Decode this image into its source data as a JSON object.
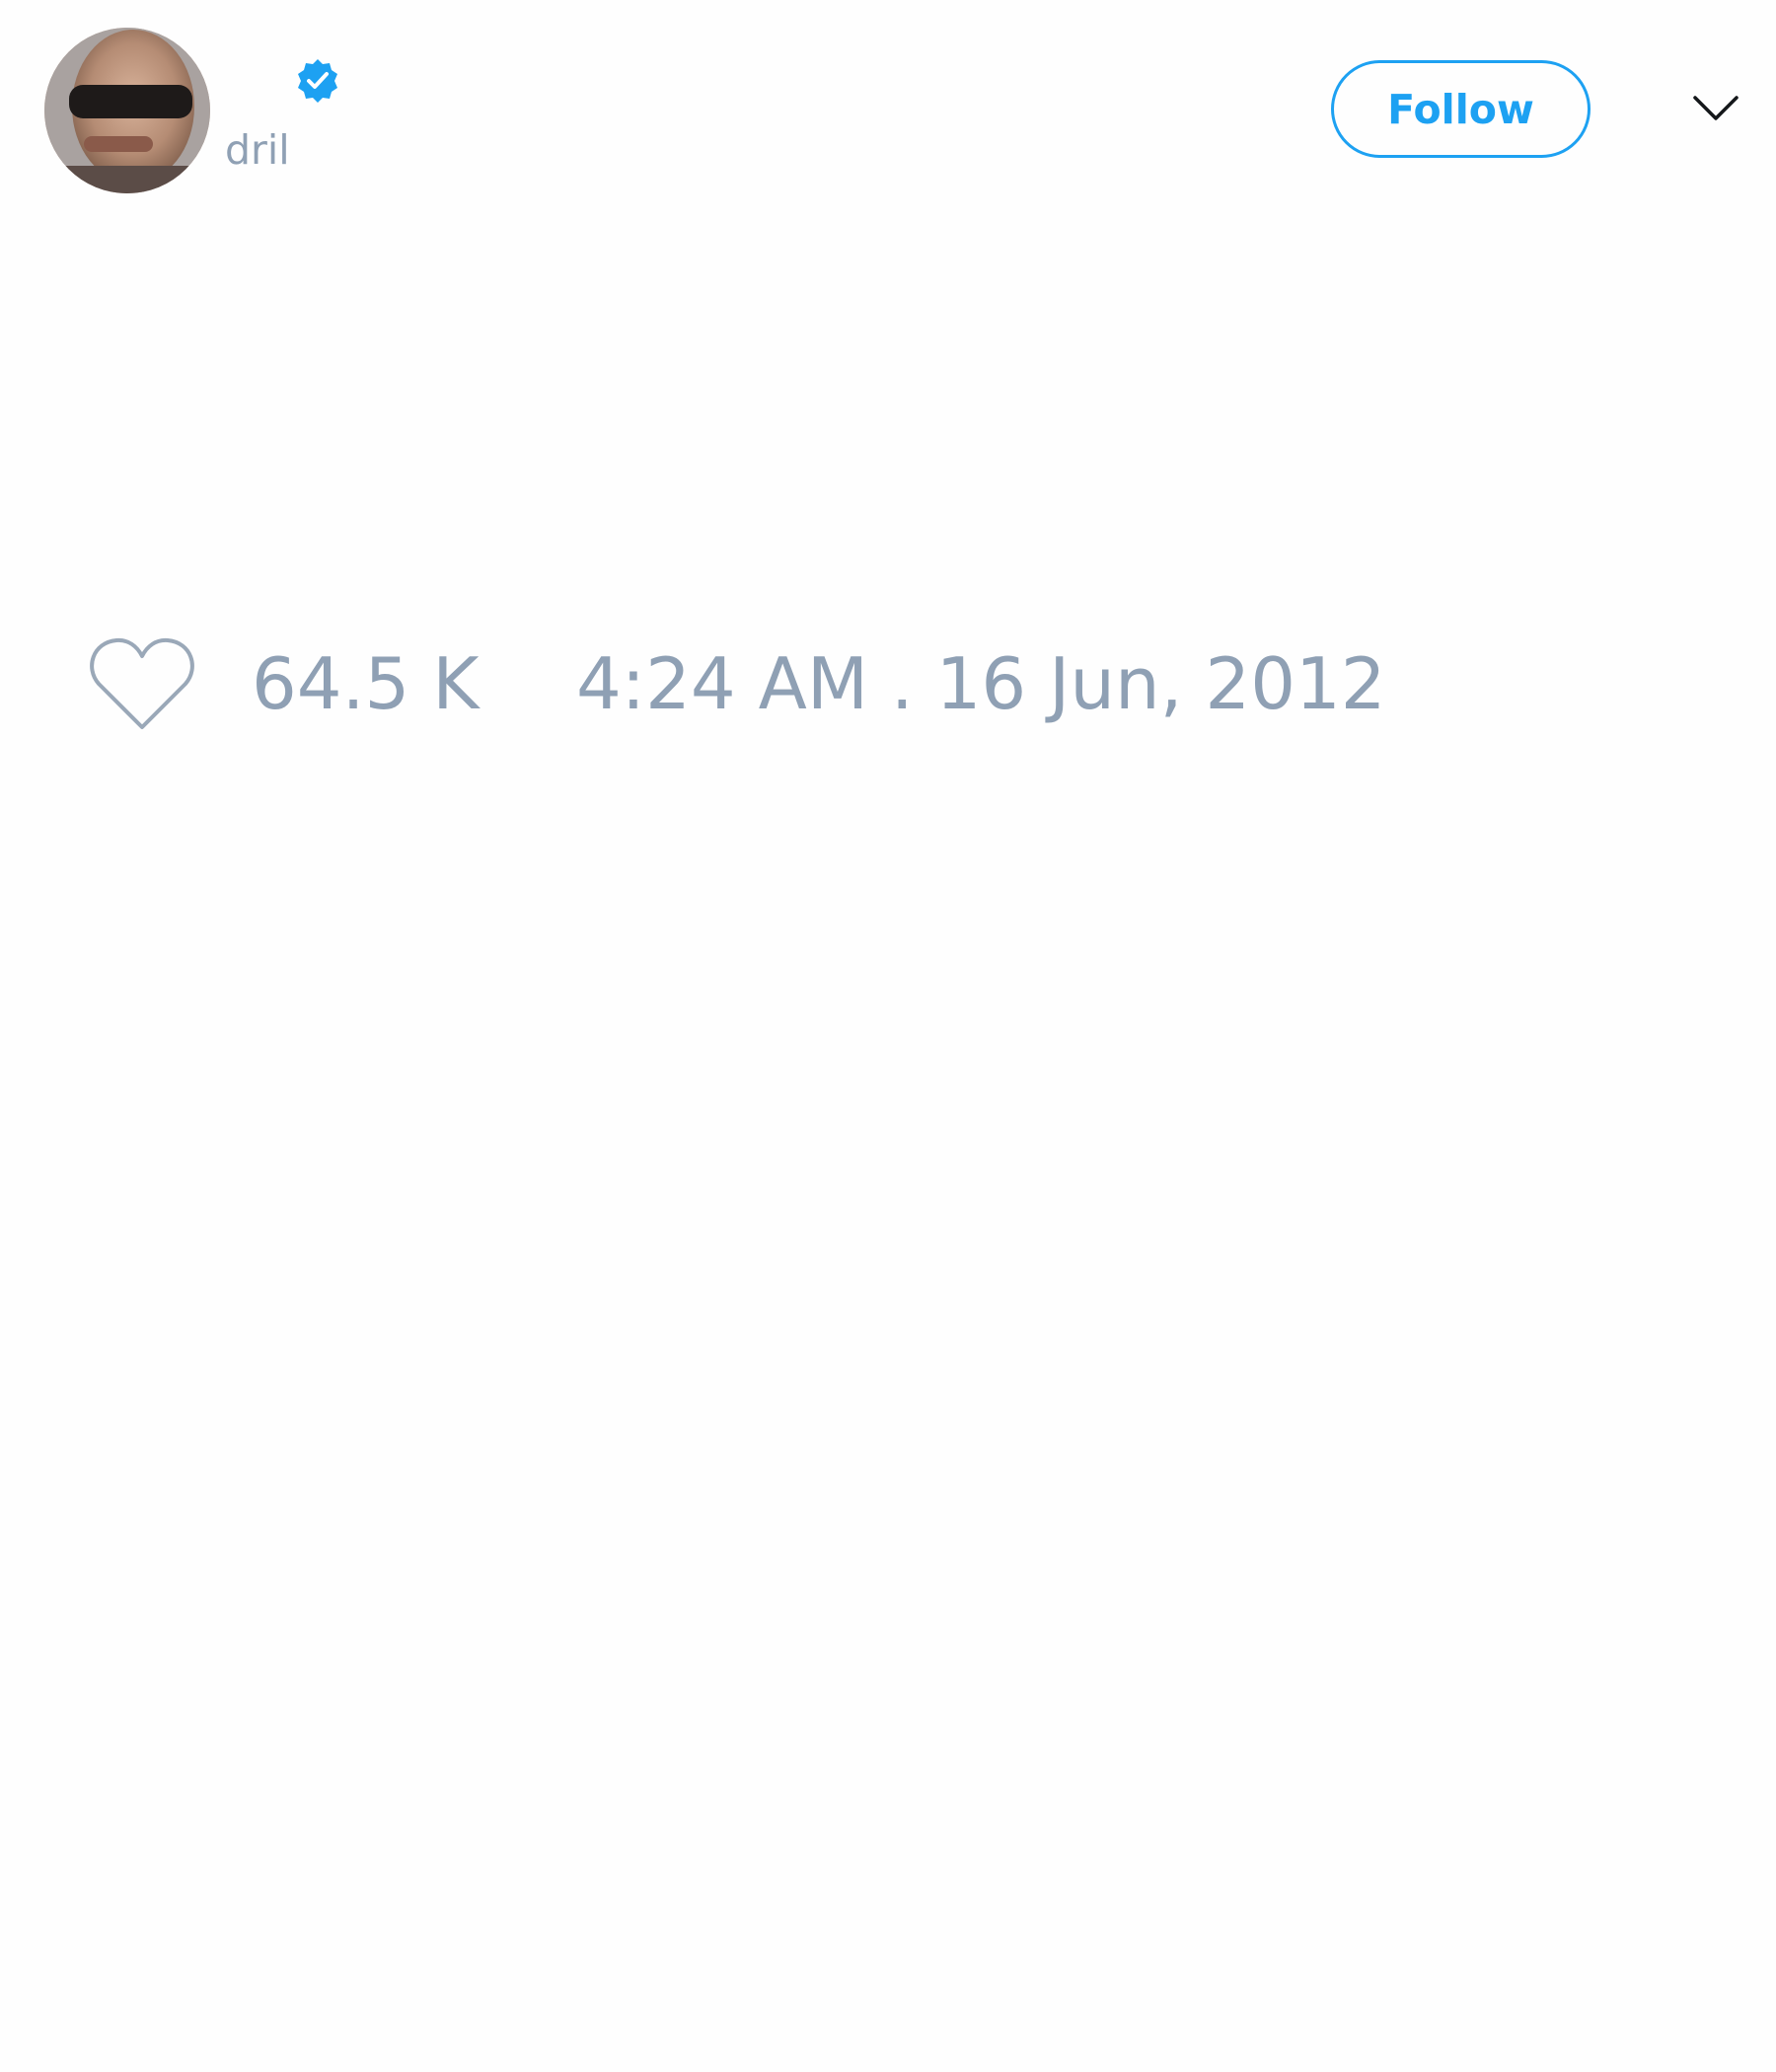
{
  "tweet": {
    "author": {
      "handle": "dril",
      "verified": true,
      "avatar_icon": "profile-photo"
    },
    "follow_button_label": "Follow",
    "menu_icon": "chevron-down-icon",
    "likes": "64.5 K",
    "timestamp": "4:24 AM . 16 Jun, 2012"
  },
  "colors": {
    "accent": "#1da1f2",
    "muted_text": "#8fa0b4",
    "background": "#fefefe"
  }
}
